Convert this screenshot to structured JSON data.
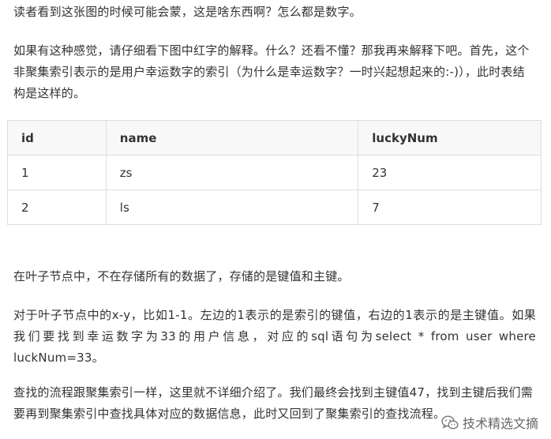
{
  "paragraphs": {
    "p1": "读者看到这张图的时候可能会蒙，这是啥东西啊？怎么都是数字。",
    "p2": "如果有这种感觉，请仔细看下图中红字的解释。什么？还看不懂？那我再来解释下吧。首先，这个非聚集索引表示的是用户幸运数字的索引（为什么是幸运数字？一时兴起想起来的:-)），此时表结构是这样的。",
    "p3": "在叶子节点中，不在存储所有的数据了，存储的是键值和主键。",
    "p4_line1": "对于叶子节点中的x-y，比如1-1。左边的1表示的是索引的键值，右边的1表示的是主键值。如果",
    "p4_line2": "我们要找到幸运数字为33的用户信息，对应的sql语句为select * from user where",
    "p4_line3": "luckNum=33。",
    "p5": "查找的流程跟聚集索引一样，这里就不详细介绍了。我们最终会找到主键值47，找到主键后我们需要再到聚集索引中查找具体对应的数据信息，此时又回到了聚集索引的查找流程。"
  },
  "table": {
    "headers": [
      "id",
      "name",
      "luckyNum"
    ],
    "rows": [
      [
        "1",
        "zs",
        "23"
      ],
      [
        "2",
        "ls",
        "7"
      ]
    ]
  },
  "watermark": {
    "text": "技术精选文摘",
    "icon": "wechat-icon"
  }
}
